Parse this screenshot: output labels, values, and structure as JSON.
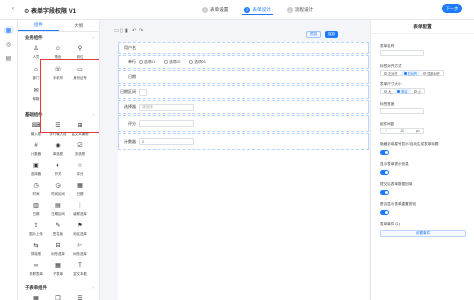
{
  "header": {
    "back_icon": "chevron-left-icon",
    "title": "⚙ 表单字段权限 V1",
    "steps": [
      {
        "num": "1",
        "label": "表单设置",
        "active": false
      },
      {
        "num": "2",
        "label": "表单设计",
        "active": true
      },
      {
        "num": "3",
        "label": "流程设计",
        "active": false
      }
    ],
    "next_label": "下一步"
  },
  "mini_sidebar": [
    "grid-icon",
    "globe-icon",
    "database-icon"
  ],
  "panel": {
    "tabs": [
      "组件",
      "大纲"
    ],
    "business": {
      "title": "业务组件",
      "items": [
        {
          "icon": "user-icon",
          "label": "人员"
        },
        {
          "icon": "role-icon",
          "label": "角色"
        },
        {
          "icon": "position-icon",
          "label": "岗位"
        },
        {
          "icon": "department-icon",
          "label": "部门"
        },
        {
          "icon": "phone-icon",
          "label": "手机号"
        },
        {
          "icon": "id-card-icon",
          "label": "身份证号"
        },
        {
          "icon": "email-icon",
          "label": "邮箱"
        }
      ]
    },
    "basic": {
      "title": "基础组件",
      "items": [
        {
          "icon": "input-icon",
          "label": "输入框"
        },
        {
          "icon": "textarea-icon",
          "label": "多行输入框"
        },
        {
          "icon": "richtext-icon",
          "label": "富文本编辑"
        },
        {
          "icon": "number-icon",
          "label": "计数器"
        },
        {
          "icon": "radio-icon",
          "label": "单选框"
        },
        {
          "icon": "checkbox-icon",
          "label": "多选框"
        },
        {
          "icon": "select-icon",
          "label": "选择器"
        },
        {
          "icon": "switch-icon",
          "label": "开关"
        },
        {
          "icon": "rate-icon",
          "label": "评分"
        },
        {
          "icon": "time-icon",
          "label": "时间"
        },
        {
          "icon": "time-range-icon",
          "label": "时间区间"
        },
        {
          "icon": "date-icon",
          "label": "日期"
        },
        {
          "icon": "calendar-icon",
          "label": "日期"
        },
        {
          "icon": "date-range-icon",
          "label": "日期区间"
        },
        {
          "icon": "cascader-icon",
          "label": "级联选择"
        },
        {
          "icon": "upload-icon",
          "label": "图片上传"
        },
        {
          "icon": "signature-icon",
          "label": "签名板"
        },
        {
          "icon": "map-icon",
          "label": "地区选择"
        },
        {
          "icon": "transfer-icon",
          "label": "穿梭框"
        },
        {
          "icon": "treeselect-icon",
          "label": "树形选择"
        },
        {
          "icon": "tree-icon",
          "label": "树形选择"
        },
        {
          "icon": "link-icon",
          "label": "关联表单"
        },
        {
          "icon": "table-icon",
          "label": "子表单"
        },
        {
          "icon": "text-icon",
          "label": "富文本框"
        }
      ]
    },
    "sub": {
      "title": "子表单组件"
    }
  },
  "canvas": {
    "devices": [
      "desktop-icon",
      "tablet-icon",
      "mobile-icon",
      "undo-icon",
      "redo-icon"
    ],
    "preview_label": "预览",
    "save_label": "保存",
    "fields": [
      {
        "label": "用户名",
        "type": "input",
        "placeholder": ""
      },
      {
        "label": "单行",
        "type": "radio",
        "options": [
          "选项01",
          "选项02",
          "选项03"
        ]
      },
      {
        "label": "日期",
        "type": "input",
        "placeholder": ""
      },
      {
        "label": "日期区间",
        "type": "input",
        "placeholder": ""
      },
      {
        "label": "选择器",
        "type": "select",
        "placeholder": "请选择"
      },
      {
        "label": "评分",
        "type": "rate",
        "placeholder": ""
      },
      {
        "label": "计数器",
        "type": "counter",
        "placeholder": "0"
      }
    ]
  },
  "config": {
    "title": "表单配置",
    "form_name_label": "表单名称",
    "label_position_label": "标签对齐方式",
    "label_position_options": [
      "左对齐",
      "右对齐",
      "顶部对齐"
    ],
    "label_position_selected": 1,
    "form_size_label": "表单尺寸大小",
    "form_size_options": [
      "大",
      "默认",
      "小"
    ],
    "form_size_selected": 1,
    "label_width_label": "标签宽度",
    "spacing_label": "组件间距",
    "spacing_value": "10",
    "spacing_unit": "px",
    "toggle1_label": "隐藏必填星号显示/自动生成表单标题",
    "toggle2_label": "显示表单提示信息",
    "toggle3_label": "提交后表单数据回填",
    "toggle4_label": "是否显示表单重置按钮",
    "events_label": "表单事件 (1)",
    "events_button": "设置事件"
  }
}
